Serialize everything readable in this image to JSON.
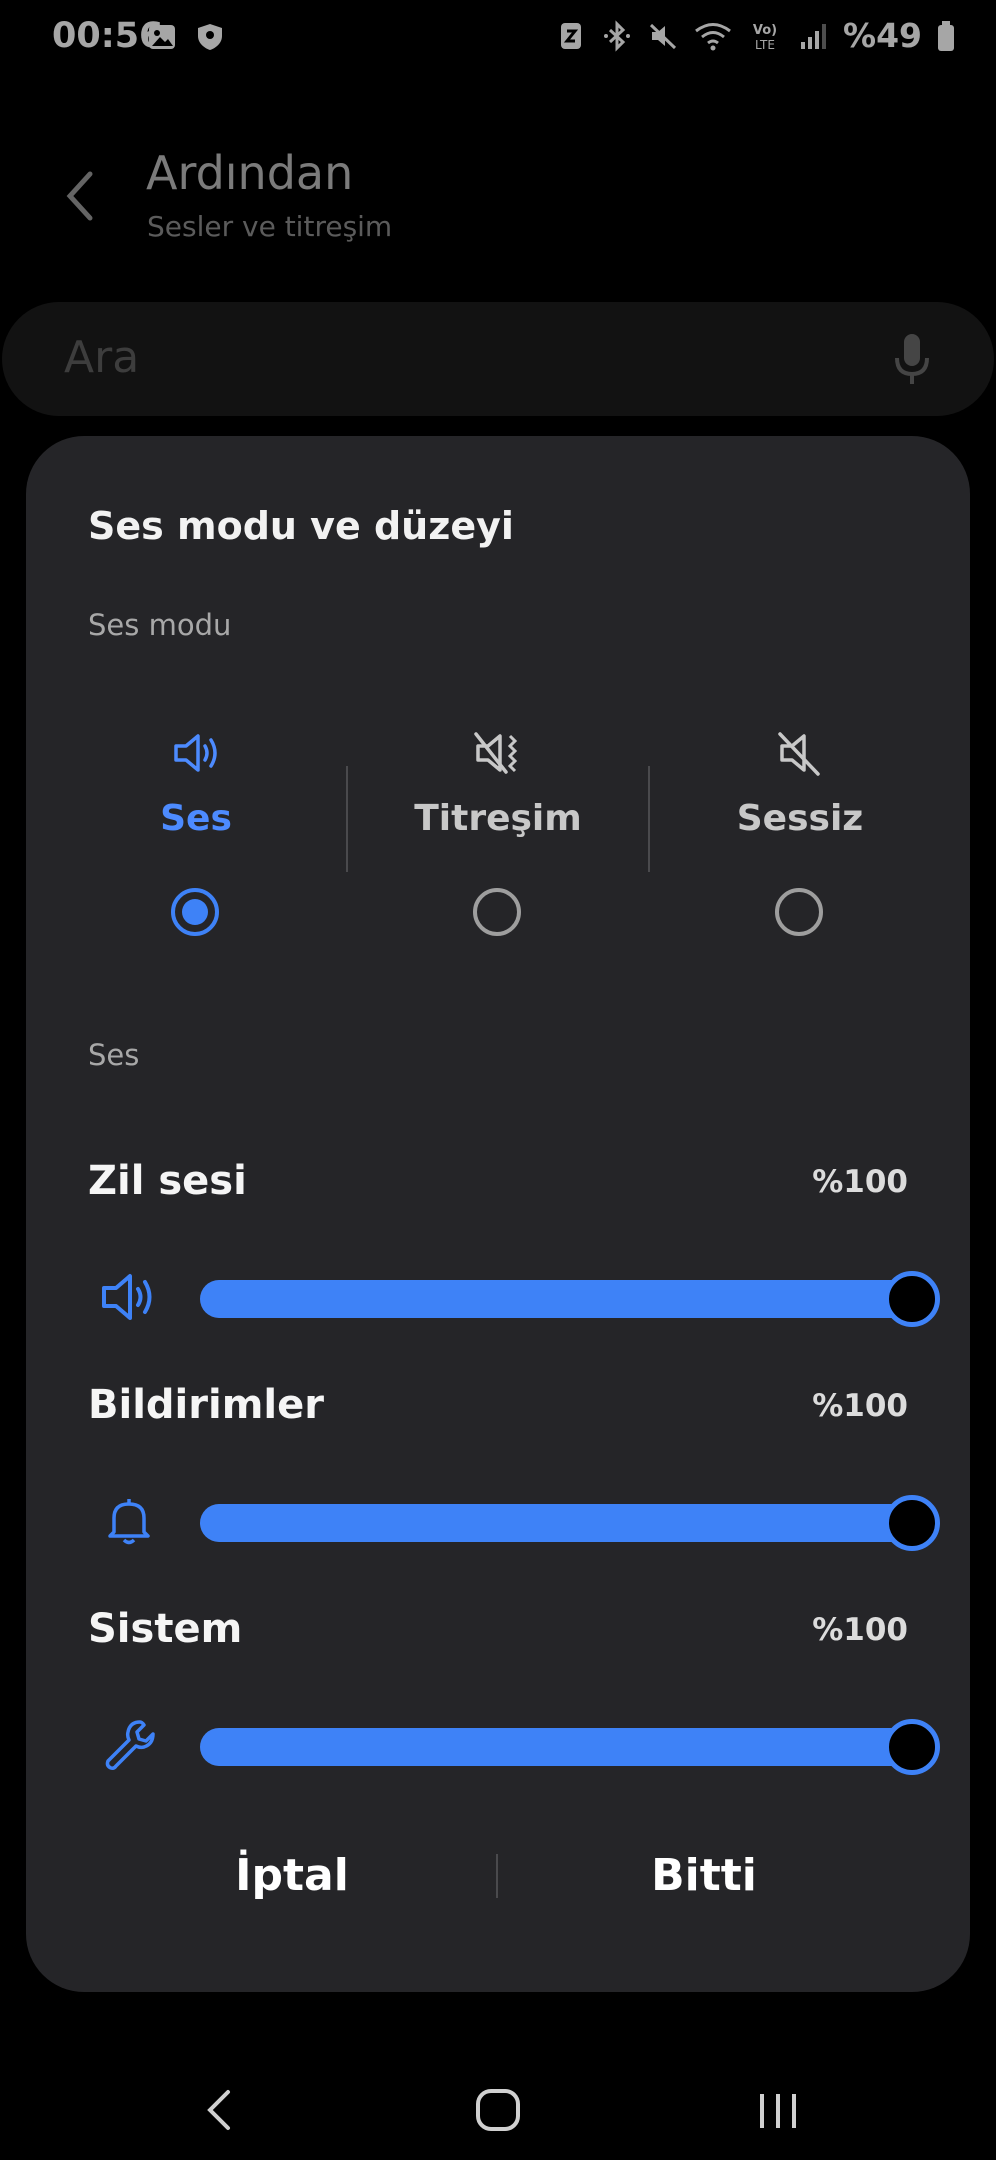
{
  "status_bar": {
    "time": "00:56",
    "left_icons": [
      "gallery-icon",
      "shield-icon"
    ],
    "right_icons": [
      "nfc-icon",
      "bluetooth-icon",
      "mute-icon",
      "wifi-icon",
      "volte-icon",
      "signal-icon"
    ],
    "battery": "%49"
  },
  "background": {
    "title": "Ardından",
    "subtitle": "Sesler ve titreşim",
    "search_placeholder": "Ara"
  },
  "dialog": {
    "title": "Ses modu ve düzeyi",
    "mode_section_label": "Ses modu",
    "modes": [
      {
        "label": "Ses",
        "icon": "speaker-icon",
        "selected": true
      },
      {
        "label": "Titreşim",
        "icon": "vibrate-icon",
        "selected": false
      },
      {
        "label": "Sessiz",
        "icon": "mute-icon",
        "selected": false
      }
    ],
    "volume_section_label": "Ses",
    "volumes": [
      {
        "label": "Zil sesi",
        "percent_text": "%100",
        "level": 1.0,
        "icon": "speaker-icon"
      },
      {
        "label": "Bildirimler",
        "percent_text": "%100",
        "level": 1.0,
        "icon": "bell-icon"
      },
      {
        "label": "Sistem",
        "percent_text": "%100",
        "level": 1.0,
        "icon": "wrench-icon"
      }
    ],
    "cancel_label": "İptal",
    "done_label": "Bitti"
  },
  "colors": {
    "accent": "#3e82f7",
    "dialog_bg": "#252528",
    "background": "#000000"
  },
  "navbar": [
    "back-icon",
    "home-icon",
    "recents-icon"
  ]
}
